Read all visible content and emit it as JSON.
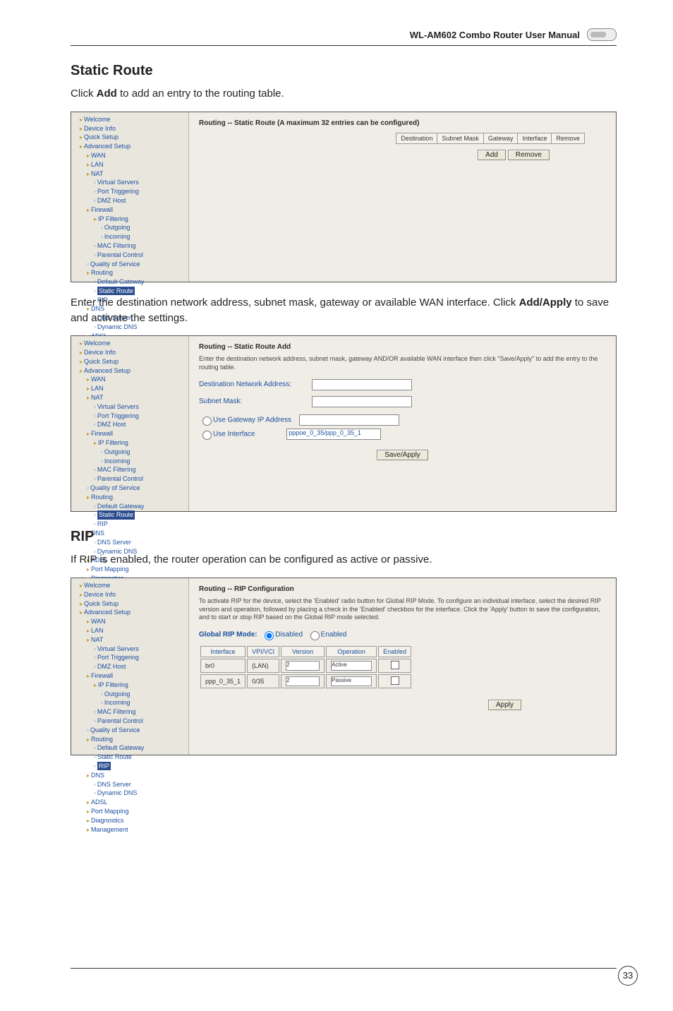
{
  "header": {
    "title": "WL-AM602 Combo Router User Manual"
  },
  "section_static": {
    "heading": "Static Route",
    "intro_a": "Click ",
    "intro_bold": "Add",
    "intro_b": " to add an entry to the routing table.",
    "middle_a": "Enter the destination network address, subnet mask, gateway or available WAN interface. Click ",
    "middle_bold": "Add/Apply",
    "middle_b": " to save and activate the settings."
  },
  "section_rip": {
    "heading": "RIP",
    "intro": "If RIP is enabled, the router operation can be configured as active or passive."
  },
  "tree": {
    "top": [
      "Welcome",
      "Device Info",
      "Quick Setup",
      "Advanced Setup"
    ],
    "adv": [
      "WAN",
      "LAN",
      "NAT"
    ],
    "nat": [
      "Virtual Servers",
      "Port Triggering",
      "DMZ Host"
    ],
    "fw": "Firewall",
    "ipf": "IP Filtering",
    "ipf_sub": [
      "Outgoing",
      "Incoming"
    ],
    "fw_rest": [
      "MAC Filtering",
      "Parental Control"
    ],
    "qos": "Quality of Service",
    "routing": "Routing",
    "routing_sub": [
      "Default Gateway",
      "Static Route",
      "RIP"
    ],
    "dns": "DNS",
    "dns_sub": [
      "DNS Server",
      "Dynamic DNS"
    ],
    "tail": [
      "ADSL",
      "Port Mapping",
      "Diagnostics",
      "Management"
    ]
  },
  "shot1": {
    "title": "Routing -- Static Route (A maximum 32 entries can be configured)",
    "cols": [
      "Destination",
      "Subnet Mask",
      "Gateway",
      "Interface",
      "Remove"
    ],
    "btn_add": "Add",
    "btn_remove": "Remove"
  },
  "shot2": {
    "title": "Routing -- Static Route Add",
    "desc": "Enter the destination network address, subnet mask, gateway AND/OR available WAN interface then click \"Save/Apply\" to add the entry to the routing table.",
    "f_dest": "Destination Network Address:",
    "f_mask": "Subnet Mask:",
    "r_gateway": "Use Gateway IP Address",
    "r_iface": "Use Interface",
    "iface_val": "pppoe_0_35/ppp_0_35_1",
    "btn": "Save/Apply"
  },
  "shot3": {
    "title": "Routing -- RIP Configuration",
    "desc": "To activate RIP for the device, select the 'Enabled' radio button for Global RIP Mode. To configure an individual interface, select the desired RIP version and operation, followed by placing a check in the 'Enabled' checkbox for the interface. Click the 'Apply' button to save the configuration, and to start or stop RIP based on the Global RIP mode selected.",
    "mode_label": "Global RIP Mode:",
    "mode_disabled": "Disabled",
    "mode_enabled": "Enabled",
    "cols": [
      "Interface",
      "VPI/VCI",
      "Version",
      "Operation",
      "Enabled"
    ],
    "row": {
      "iface": "br0",
      "vpi": "(LAN)",
      "ver": "2",
      "op": "Active"
    },
    "row2": {
      "iface": "ppp_0_35_1",
      "vpi": "0/35",
      "ver": "2",
      "op": "Passive"
    },
    "btn": "Apply"
  },
  "page_number": "33"
}
